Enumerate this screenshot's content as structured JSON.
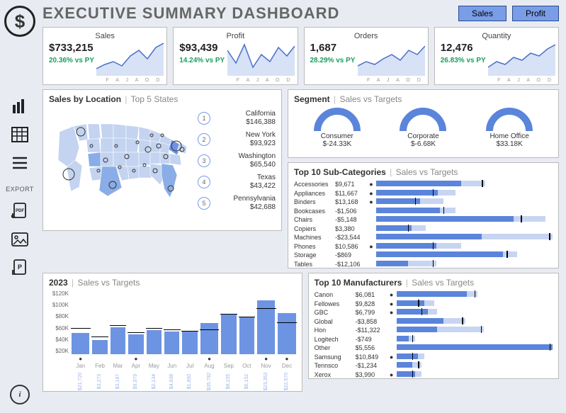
{
  "title": "EXECUTIVE SUMMARY DASHBOARD",
  "tabs": [
    "Sales",
    "Profit"
  ],
  "export_label": "EXPORT",
  "kpis": [
    {
      "title": "Sales",
      "value": "$733,215",
      "delta": "20.36% vs PY"
    },
    {
      "title": "Profit",
      "value": "$93,439",
      "delta": "14.24% vs PY"
    },
    {
      "title": "Orders",
      "value": "1,687",
      "delta": "28.29% vs PY"
    },
    {
      "title": "Quantity",
      "value": "12,476",
      "delta": "26.83% vs PY"
    }
  ],
  "kpi_months": "F A J A O D",
  "location": {
    "title": "Sales by Location",
    "subtitle": "Top 5 States",
    "states": [
      {
        "rank": "1",
        "name": "California",
        "value": "$146,388"
      },
      {
        "rank": "2",
        "name": "New York",
        "value": "$93,923"
      },
      {
        "rank": "3",
        "name": "Washington",
        "value": "$65,540"
      },
      {
        "rank": "4",
        "name": "Texas",
        "value": "$43,422"
      },
      {
        "rank": "5",
        "name": "Pennsylvania",
        "value": "$42,688"
      }
    ]
  },
  "segments": {
    "title": "Segment",
    "subtitle": "Sales vs Targets",
    "items": [
      {
        "name": "Consumer",
        "value": "$-24.33K"
      },
      {
        "name": "Corporate",
        "value": "$-6.68K"
      },
      {
        "name": "Home Office",
        "value": "$33.18K"
      }
    ]
  },
  "subcats": {
    "title": "Top 10 Sub-Categories",
    "subtitle": "Sales vs Targets",
    "rows": [
      {
        "label": "Accessories",
        "value": "$9,671",
        "dot": true,
        "fg": 48,
        "bg": 62,
        "tick": 60
      },
      {
        "label": "Appliances",
        "value": "$11,667",
        "dot": true,
        "fg": 35,
        "bg": 45,
        "tick": 32
      },
      {
        "label": "Binders",
        "value": "$13,168",
        "dot": true,
        "fg": 25,
        "bg": 38,
        "tick": 22
      },
      {
        "label": "Bookcases",
        "value": "-$1,506",
        "dot": false,
        "fg": 36,
        "bg": 45,
        "tick": 38
      },
      {
        "label": "Chairs",
        "value": "-$5,148",
        "dot": false,
        "fg": 78,
        "bg": 96,
        "tick": 82
      },
      {
        "label": "Copiers",
        "value": "$3,380",
        "dot": false,
        "fg": 20,
        "bg": 28,
        "tick": 18
      },
      {
        "label": "Machines",
        "value": "-$23,544",
        "dot": false,
        "fg": 60,
        "bg": 100,
        "tick": 98
      },
      {
        "label": "Phones",
        "value": "$10,586",
        "dot": true,
        "fg": 34,
        "bg": 48,
        "tick": 32
      },
      {
        "label": "Storage",
        "value": "-$869",
        "dot": false,
        "fg": 72,
        "bg": 80,
        "tick": 74
      },
      {
        "label": "Tables",
        "value": "-$12,106",
        "dot": false,
        "fg": 18,
        "bg": 34,
        "tick": 32
      }
    ]
  },
  "manufacturers": {
    "title": "Top 10 Manufacturers",
    "subtitle": "Sales vs Targets",
    "rows": [
      {
        "label": "Canon",
        "value": "$6,081",
        "dot": true,
        "fg": 45,
        "bg": 52,
        "tick": 50
      },
      {
        "label": "Fellowes",
        "value": "$9,828",
        "dot": true,
        "fg": 18,
        "bg": 24,
        "tick": 14
      },
      {
        "label": "GBC",
        "value": "$6,799",
        "dot": true,
        "fg": 20,
        "bg": 26,
        "tick": 16
      },
      {
        "label": "Global",
        "value": "-$3,858",
        "dot": false,
        "fg": 30,
        "bg": 44,
        "tick": 42
      },
      {
        "label": "Hon",
        "value": "-$11,322",
        "dot": false,
        "fg": 26,
        "bg": 56,
        "tick": 54
      },
      {
        "label": "Logitech",
        "value": "-$749",
        "dot": false,
        "fg": 8,
        "bg": 12,
        "tick": 10
      },
      {
        "label": "Other",
        "value": "$5,556",
        "dot": false,
        "fg": 100,
        "bg": 100,
        "tick": 98
      },
      {
        "label": "Samsung",
        "value": "$10,849",
        "dot": true,
        "fg": 14,
        "bg": 18,
        "tick": 10
      },
      {
        "label": "Tennsco",
        "value": "-$1,234",
        "dot": false,
        "fg": 10,
        "bg": 16,
        "tick": 14
      },
      {
        "label": "Xerox",
        "value": "$3,990",
        "dot": true,
        "fg": 12,
        "bg": 16,
        "tick": 10
      }
    ]
  },
  "monthly": {
    "title": "2023",
    "subtitle": "Sales vs Targets",
    "ylabels": [
      "$120K",
      "$100K",
      "$80K",
      "$60K",
      "$40K",
      "$20K"
    ],
    "months": [
      {
        "name": "Jan",
        "value": "$21,720",
        "h": 30,
        "tick": 40,
        "dot": true
      },
      {
        "name": "Feb",
        "value": "$3,273",
        "h": 20,
        "tick": 28,
        "dot": false
      },
      {
        "name": "Mar",
        "value": "$3,187",
        "h": 38,
        "tick": 44,
        "dot": false
      },
      {
        "name": "Apr",
        "value": "$9,979",
        "h": 28,
        "tick": 34,
        "dot": true
      },
      {
        "name": "May",
        "value": "$2,134",
        "h": 34,
        "tick": 40,
        "dot": false
      },
      {
        "name": "Jun",
        "value": "$4,638",
        "h": 32,
        "tick": 38,
        "dot": false
      },
      {
        "name": "Jul",
        "value": "$1,850",
        "h": 32,
        "tick": 36,
        "dot": false
      },
      {
        "name": "Aug",
        "value": "$35,782",
        "h": 44,
        "tick": 38,
        "dot": true
      },
      {
        "name": "Sep",
        "value": "$8,225",
        "h": 56,
        "tick": 60,
        "dot": false
      },
      {
        "name": "Oct",
        "value": "$6,152",
        "h": 52,
        "tick": 56,
        "dot": false
      },
      {
        "name": "Nov",
        "value": "$23,353",
        "h": 76,
        "tick": 68,
        "dot": true
      },
      {
        "name": "Dec",
        "value": "$22,570",
        "h": 58,
        "tick": 48,
        "dot": true
      }
    ]
  },
  "chart_data": {
    "kpis": [
      {
        "name": "Sales",
        "value": 733215,
        "delta_pct": 20.36
      },
      {
        "name": "Profit",
        "value": 93439,
        "delta_pct": 14.24
      },
      {
        "name": "Orders",
        "value": 1687,
        "delta_pct": 28.29
      },
      {
        "name": "Quantity",
        "value": 12476,
        "delta_pct": 26.83
      }
    ],
    "top_states": [
      {
        "state": "California",
        "sales": 146388
      },
      {
        "state": "New York",
        "sales": 93923
      },
      {
        "state": "Washington",
        "sales": 65540
      },
      {
        "state": "Texas",
        "sales": 43422
      },
      {
        "state": "Pennsylvania",
        "sales": 42688
      }
    ],
    "segments": [
      {
        "name": "Consumer",
        "vs_target": -24330
      },
      {
        "name": "Corporate",
        "vs_target": -6680
      },
      {
        "name": "Home Office",
        "vs_target": 33180
      }
    ],
    "subcategories": [
      {
        "name": "Accessories",
        "vs_target": 9671
      },
      {
        "name": "Appliances",
        "vs_target": 11667
      },
      {
        "name": "Binders",
        "vs_target": 13168
      },
      {
        "name": "Bookcases",
        "vs_target": -1506
      },
      {
        "name": "Chairs",
        "vs_target": -5148
      },
      {
        "name": "Copiers",
        "vs_target": 3380
      },
      {
        "name": "Machines",
        "vs_target": -23544
      },
      {
        "name": "Phones",
        "vs_target": 10586
      },
      {
        "name": "Storage",
        "vs_target": -869
      },
      {
        "name": "Tables",
        "vs_target": -12106
      }
    ],
    "manufacturers": [
      {
        "name": "Canon",
        "vs_target": 6081
      },
      {
        "name": "Fellowes",
        "vs_target": 9828
      },
      {
        "name": "GBC",
        "vs_target": 6799
      },
      {
        "name": "Global",
        "vs_target": -3858
      },
      {
        "name": "Hon",
        "vs_target": -11322
      },
      {
        "name": "Logitech",
        "vs_target": -749
      },
      {
        "name": "Other",
        "vs_target": 5556
      },
      {
        "name": "Samsung",
        "vs_target": 10849
      },
      {
        "name": "Tennsco",
        "vs_target": -1234
      },
      {
        "name": "Xerox",
        "vs_target": 3990
      }
    ],
    "monthly_2023": {
      "type": "bar",
      "categories": [
        "Jan",
        "Feb",
        "Mar",
        "Apr",
        "May",
        "Jun",
        "Jul",
        "Aug",
        "Sep",
        "Oct",
        "Nov",
        "Dec"
      ],
      "values": [
        21720,
        3273,
        3187,
        9979,
        2134,
        4638,
        1850,
        35782,
        8225,
        6152,
        23353,
        22570
      ],
      "ylabel": "Sales",
      "ylim": [
        0,
        120000
      ]
    }
  }
}
